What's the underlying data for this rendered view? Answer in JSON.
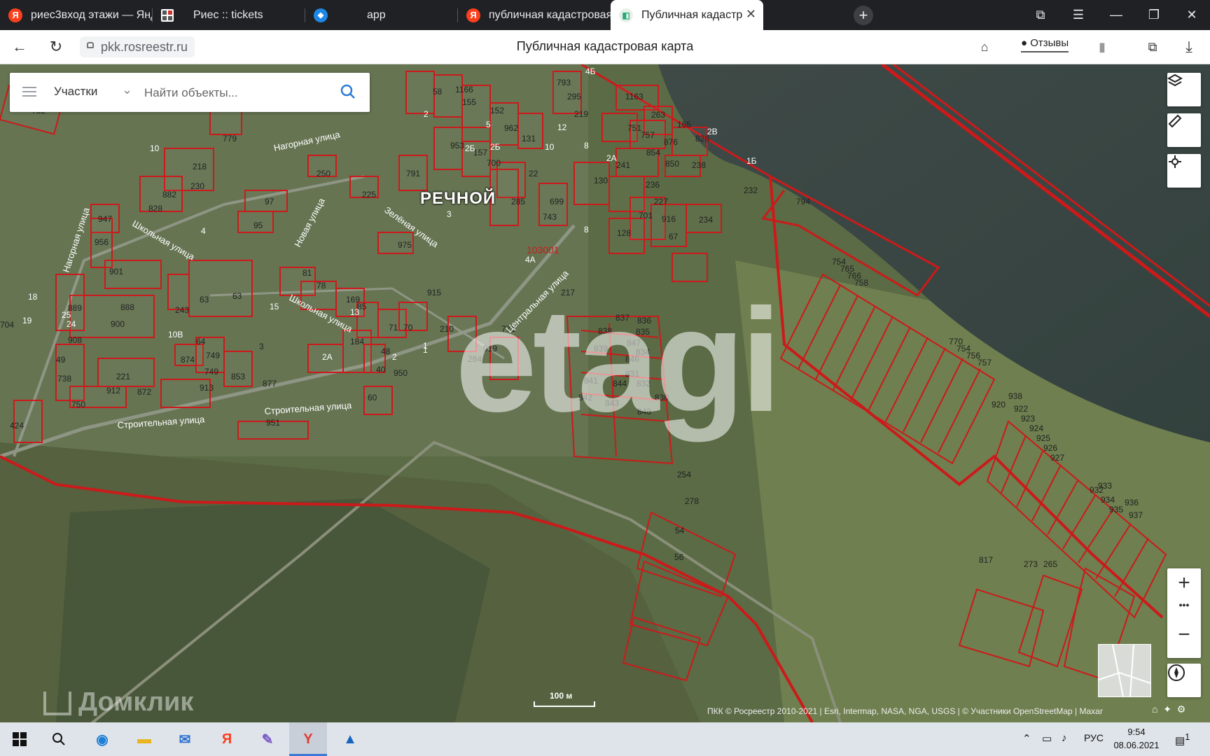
{
  "browser": {
    "tabs": [
      {
        "label": "риес3вход этажи — Яндекс",
        "icon": "yandex-icon"
      },
      {
        "label": "Риес :: tickets",
        "icon": "grid-icon"
      },
      {
        "label": "app",
        "icon": "app-icon"
      },
      {
        "label": "публичная кадастровая карта",
        "icon": "yandex-icon"
      },
      {
        "label": "Публичная кадастровая карта",
        "icon": "pkk-icon",
        "active": true
      }
    ],
    "new_tab_label": "+",
    "close_tab_label": "✕",
    "url": "pkk.rosreestr.ru",
    "page_title": "Публичная кадастровая карта",
    "reviews_label": "Отзывы"
  },
  "map": {
    "search": {
      "category": "Участки",
      "placeholder": "Найти объекты..."
    },
    "village_name": "РЕЧНОЙ",
    "block_label": "103001",
    "watermark": "etagi",
    "brand_watermark": "Домклик",
    "scale_label": "100 м",
    "attribution": "ПКК © Росреестр 2010-2021 | Esri, Intermap, NASA, NGA, USGS | © Участники OpenStreetMap | Maxar",
    "controls": {
      "zoom_in": "+",
      "zoom_more": "•••",
      "zoom_out": "−"
    },
    "streets": [
      "Нагорная улица",
      "Школьная улица",
      "Новая улица",
      "Зелёная улица",
      "Центральная улица",
      "Школьная улица",
      "Строительная улица",
      "Строительная улица",
      "Нагорная улица"
    ],
    "plots": [
      "732",
      "58",
      "1166",
      "155",
      "152",
      "962",
      "131",
      "1163",
      "263",
      "165",
      "793",
      "295",
      "219",
      "779",
      "953",
      "157",
      "700",
      "22",
      "751",
      "757",
      "876",
      "826",
      "854",
      "850",
      "238",
      "218",
      "230",
      "882",
      "828",
      "250",
      "225",
      "791",
      "285",
      "699",
      "743",
      "130",
      "241",
      "236",
      "227",
      "701",
      "916",
      "234",
      "947",
      "956",
      "97",
      "95",
      "975",
      "128",
      "67",
      "794",
      "901",
      "63",
      "63",
      "243",
      "81",
      "78",
      "169",
      "85",
      "915",
      "217",
      "889",
      "888",
      "900",
      "704",
      "908",
      "874",
      "749",
      "749",
      "853",
      "64",
      "3",
      "184",
      "48",
      "40",
      "950",
      "71",
      "70",
      "210",
      "771",
      "919",
      "284",
      "837",
      "836",
      "838",
      "847",
      "839",
      "846",
      "834",
      "835",
      "831",
      "832",
      "841",
      "844",
      "842",
      "843",
      "848",
      "830",
      "49",
      "221",
      "738",
      "912",
      "872",
      "750",
      "913",
      "877",
      "424",
      "60",
      "951",
      "254",
      "278",
      "54",
      "56",
      "754",
      "765",
      "766",
      "758",
      "770",
      "754",
      "756",
      "757",
      "920",
      "938",
      "922",
      "923",
      "924",
      "925",
      "926",
      "927",
      "932",
      "933",
      "934",
      "935",
      "936",
      "937",
      "817",
      "273",
      "265",
      "232"
    ],
    "house_numbers": [
      "2",
      "10",
      "4",
      "24",
      "18",
      "19",
      "25",
      "10В",
      "15",
      "13",
      "2А",
      "2Б",
      "1",
      "3",
      "2",
      "5",
      "2Б",
      "10",
      "8",
      "12",
      "2В",
      "1Б",
      "4Б",
      "2А",
      "4А",
      "8",
      "1"
    ]
  },
  "taskbar": {
    "apps": [
      "windows-start",
      "search",
      "edge",
      "file-explorer",
      "mail",
      "yandex",
      "paint",
      "yandex-browser",
      "photos"
    ],
    "language": "РУС",
    "time": "9:54",
    "date": "08.06.2021",
    "notifications_count": "1"
  }
}
